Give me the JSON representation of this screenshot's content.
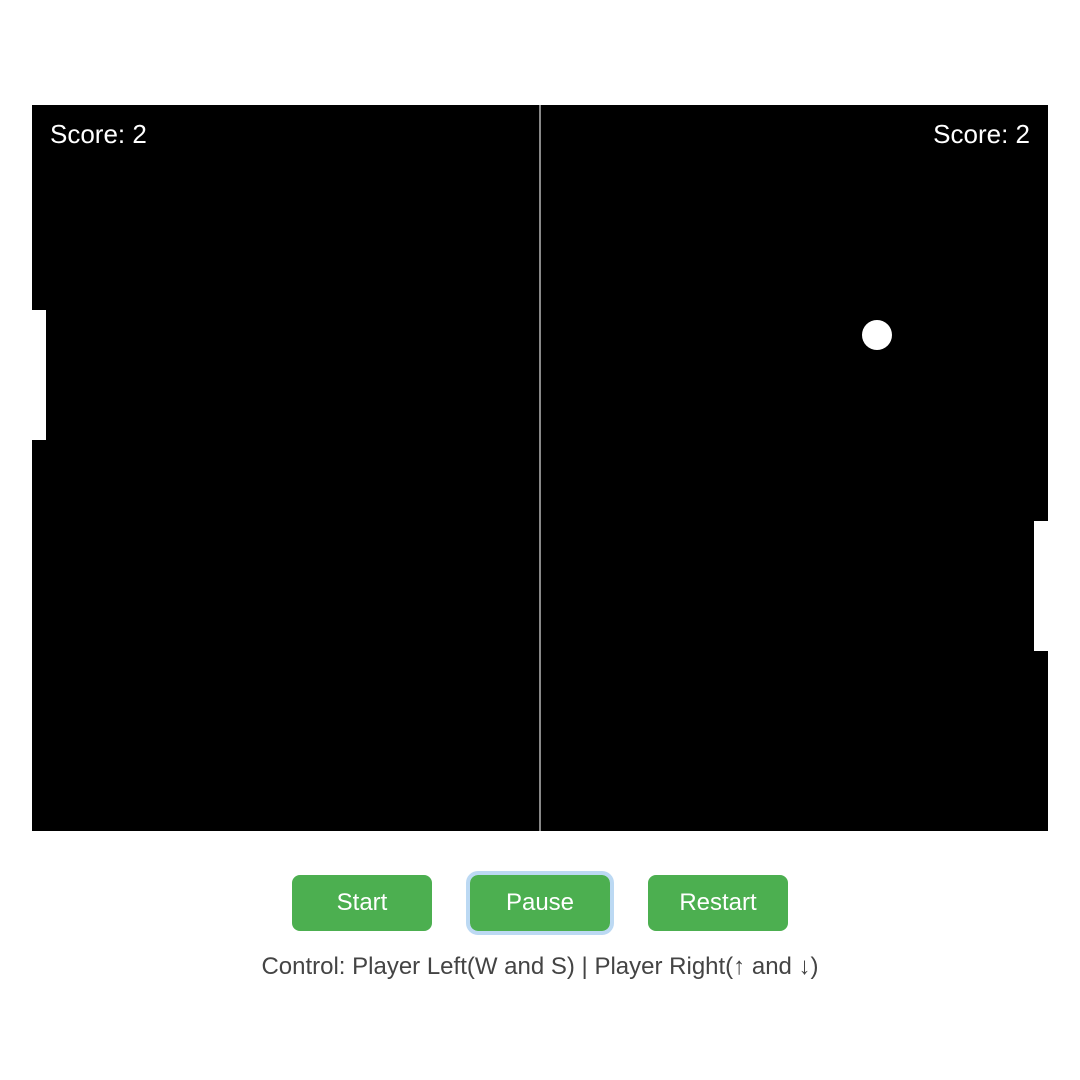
{
  "score": {
    "left_prefix": "Score: ",
    "left_value": "2",
    "right_prefix": "Score: ",
    "right_value": "2"
  },
  "buttons": {
    "start": "Start",
    "pause": "Pause",
    "restart": "Restart"
  },
  "instructions": "Control: Player Left(W and S) | Player Right(↑ and ↓)"
}
